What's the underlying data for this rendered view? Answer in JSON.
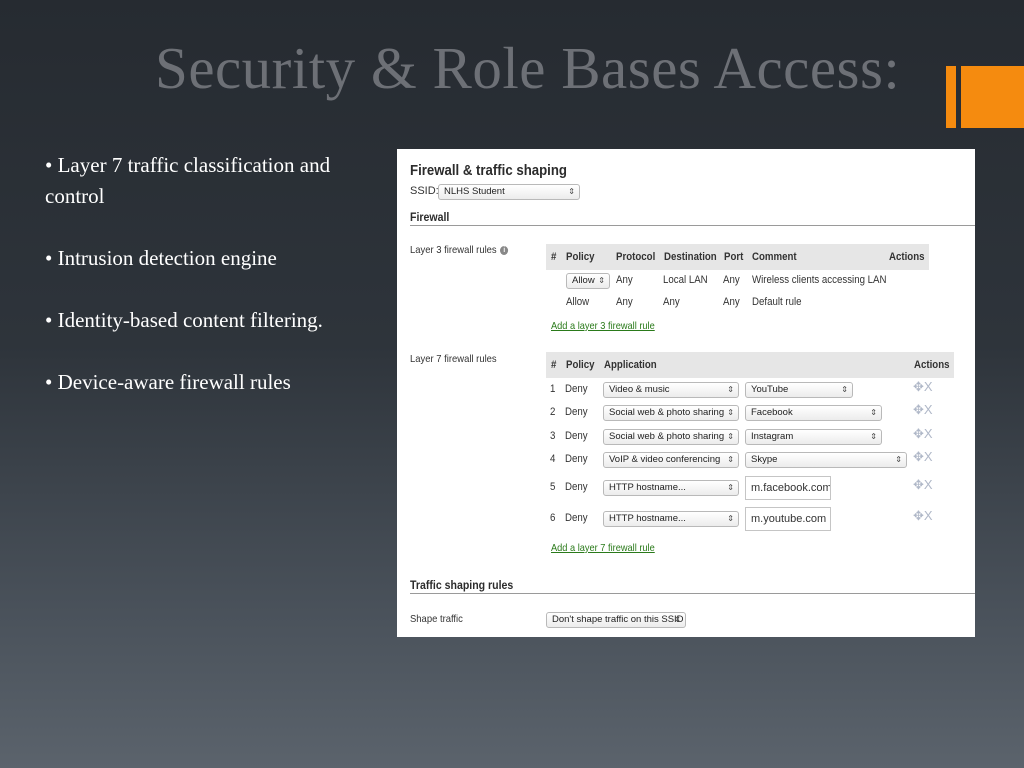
{
  "slide": {
    "title": "Security & Role Bases Access:",
    "accent_color": "#f58b0f",
    "bullets": [
      "• Layer 7 traffic classification and control",
      "• Intrusion detection engine",
      "• Identity-based content filtering.",
      "• Device-aware firewall rules"
    ]
  },
  "screenshot": {
    "title": "Firewall & traffic shaping",
    "ssid_label": "SSID:",
    "ssid_value": "NLHS Student",
    "firewall_heading": "Firewall",
    "layer3": {
      "label": "Layer 3 firewall rules",
      "info_icon": "i",
      "headers": [
        "#",
        "Policy",
        "Protocol",
        "Destination",
        "Port",
        "Comment",
        "Actions"
      ],
      "rows": [
        {
          "policy": "Allow",
          "protocol": "Any",
          "destination": "Local LAN",
          "port": "Any",
          "comment": "Wireless clients accessing LAN"
        },
        {
          "policy": "Allow",
          "protocol": "Any",
          "destination": "Any",
          "port": "Any",
          "comment": "Default rule"
        }
      ],
      "add_link": "Add a layer 3 firewall rule"
    },
    "layer7": {
      "label": "Layer 7 firewall rules",
      "headers": [
        "#",
        "Policy",
        "Application",
        "Actions"
      ],
      "rows": [
        {
          "num": "1",
          "policy": "Deny",
          "application": "Video & music",
          "value": "YouTube"
        },
        {
          "num": "2",
          "policy": "Deny",
          "application": "Social web & photo sharing",
          "value": "Facebook"
        },
        {
          "num": "3",
          "policy": "Deny",
          "application": "Social web & photo sharing",
          "value": "Instagram"
        },
        {
          "num": "4",
          "policy": "Deny",
          "application": "VoIP & video conferencing",
          "value": "Skype"
        },
        {
          "num": "5",
          "policy": "Deny",
          "application": "HTTP hostname...",
          "value": "m.facebook.com"
        },
        {
          "num": "6",
          "policy": "Deny",
          "application": "HTTP hostname...",
          "value": "m.youtube.com"
        }
      ],
      "move_icon": "✥",
      "delete_icon": "X",
      "add_link": "Add a layer 7 firewall rule"
    },
    "traffic": {
      "heading": "Traffic shaping rules",
      "label": "Shape traffic",
      "value": "Don't shape traffic on this SSID"
    },
    "select_arrows": "⇕",
    "link_color": "#2a7a1a"
  }
}
